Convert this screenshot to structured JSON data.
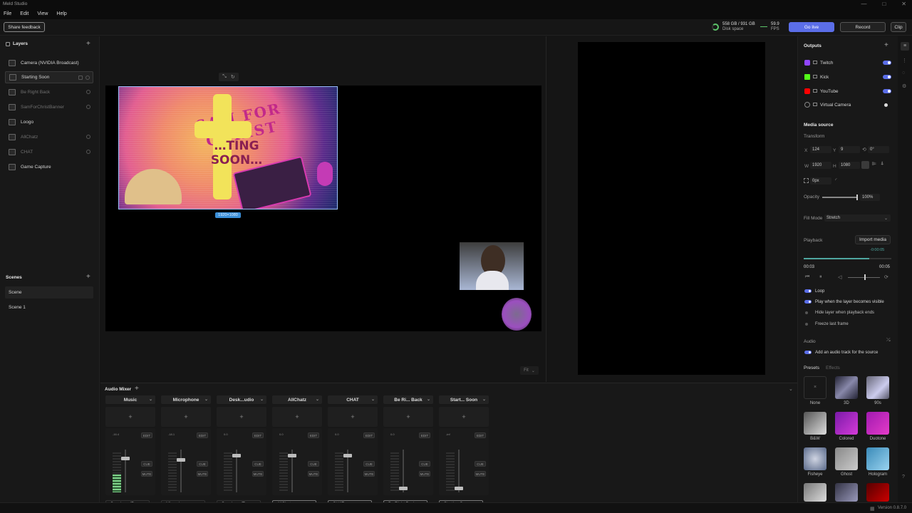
{
  "window": {
    "title": "Meld Studio",
    "controls": [
      "—",
      "□",
      "✕"
    ]
  },
  "menu": [
    "File",
    "Edit",
    "View",
    "Help"
  ],
  "toolbar": {
    "share_feedback": "Share feedback",
    "disk_space_value": "558 GB / 931 GB",
    "disk_space_label": "Disk space",
    "fps_value": "59.9",
    "fps_label": "FPS",
    "go_live": "Go live",
    "record": "Record",
    "clip": "Clip",
    "accent_color": "#5b6ee8"
  },
  "layers": {
    "title": "Layers",
    "items": [
      {
        "label": "Camera (NVIDIA Broadcast)",
        "dim": false,
        "selected": false
      },
      {
        "label": "Starting Soon",
        "dim": false,
        "selected": true
      },
      {
        "label": "Be Right Back",
        "dim": true,
        "selected": false
      },
      {
        "label": "SamForChristBanner",
        "dim": true,
        "selected": false
      },
      {
        "label": "Loogo",
        "dim": false,
        "selected": false
      },
      {
        "label": "AllChatz",
        "dim": true,
        "selected": false
      },
      {
        "label": "CHAT",
        "dim": true,
        "selected": false
      },
      {
        "label": "Game Capture",
        "dim": false,
        "selected": false
      }
    ]
  },
  "scenes": {
    "title": "Scenes",
    "items": [
      {
        "label": "Scene",
        "selected": true
      },
      {
        "label": "Scene 1",
        "selected": false
      }
    ]
  },
  "canvas": {
    "source_title": "SAM FOR CHRIST",
    "source_subtitle": "…TING SOON…",
    "source_size": "1920×1080",
    "fit_label": "Fit"
  },
  "mixer": {
    "title": "Audio Mixer",
    "channels": [
      {
        "name": "Music",
        "output": "Speakers (R...",
        "level": 0.45,
        "boxed": false,
        "db": "-16.4"
      },
      {
        "name": "Microphone",
        "output": "Microphone...",
        "level": 0,
        "boxed": false,
        "db": "-18.1"
      },
      {
        "name": "Desk...udio",
        "output": "Speakers (T...",
        "level": 0,
        "boxed": false,
        "db": "0.0"
      },
      {
        "name": "AllChatz",
        "output": "AllChatz",
        "level": 0,
        "boxed": true,
        "db": "0.0"
      },
      {
        "name": "CHAT",
        "output": "CHAT",
        "level": 0,
        "boxed": true,
        "db": "0.0"
      },
      {
        "name": "Be Ri... Back",
        "output": "Be Right Back",
        "level": 0,
        "boxed": true,
        "db": "0.0"
      },
      {
        "name": "Start... Soon",
        "output": "Starting Soon",
        "level": 0,
        "boxed": true,
        "db": "-inf"
      }
    ],
    "btn_edit": "EDIT",
    "btn_cue": "CUE",
    "btn_mute": "MUTE"
  },
  "outputs": {
    "title": "Outputs",
    "items": [
      {
        "label": "Twitch",
        "color": "#9146ff",
        "on": true
      },
      {
        "label": "Kick",
        "color": "#53fc18",
        "on": true
      },
      {
        "label": "YouTube",
        "color": "#ff0000",
        "on": true
      },
      {
        "label": "Virtual Camera",
        "color": "#888888",
        "on": false
      }
    ]
  },
  "media_source": {
    "title": "Media source",
    "transform_label": "Transform",
    "x_label": "X",
    "x": "124",
    "y_label": "Y",
    "y": "9",
    "rotation": "0°",
    "w_label": "W",
    "w": "1920",
    "h_label": "H",
    "h": "1080",
    "corner": "0px",
    "opacity_label": "Opacity",
    "opacity": "100%",
    "fill_mode_label": "Fill Mode",
    "fill_mode": "Stretch",
    "playback_label": "Playback",
    "import_media": "Import media",
    "remaining": "-0:00:05",
    "time_current": "00:03",
    "time_total": "00:05",
    "progress": 0.75,
    "loop": "Loop",
    "play_visible": "Play when the layer becomes visible",
    "hide_end": "Hide layer when playback ends",
    "freeze": "Freeze last frame",
    "audio_label": "Audio",
    "audio_track": "Add an audio track for the source"
  },
  "presets": {
    "tab_presets": "Presets",
    "tab_effects": "Effects",
    "items": [
      "None",
      "3D",
      "90s",
      "B&W",
      "Colored",
      "Duotone",
      "Fisheye",
      "Ghost",
      "Hologram"
    ]
  },
  "status": {
    "version": "Version 0.8.7.0"
  }
}
